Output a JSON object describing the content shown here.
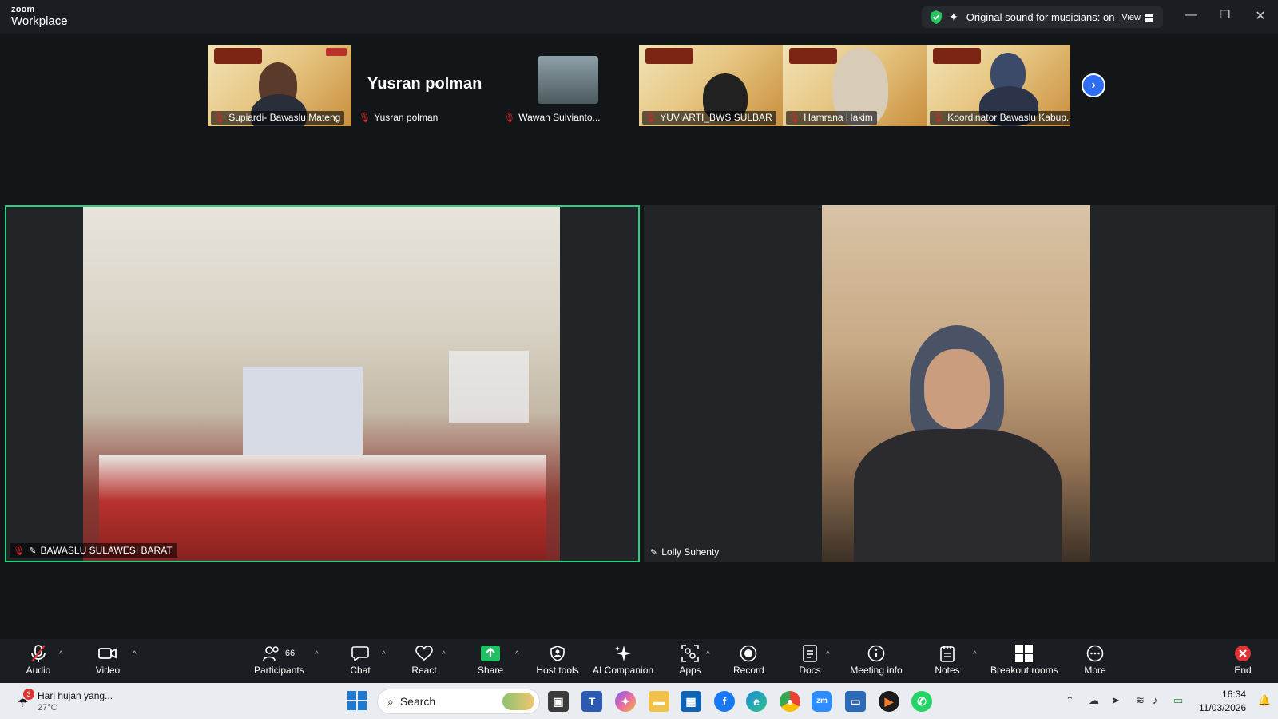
{
  "titlebar": {
    "brand_small": "zoom",
    "brand_large": "Workplace",
    "sound_status": "Original sound for musicians: on",
    "view_label": "View",
    "minimize": "—",
    "restore": "❐",
    "close": "✕"
  },
  "gallery": {
    "tiles": [
      {
        "label": "Supiardi- Bawaslu Mateng"
      },
      {
        "label": "Yusran polman",
        "display_name": "Yusran polman"
      },
      {
        "label": "Wawan Sulvianto..."
      },
      {
        "label": "YUVIARTI_BWS SULBAR"
      },
      {
        "label": "Hamrana Hakim"
      },
      {
        "label": "Koordinator Bawaslu Kabup..."
      }
    ],
    "next_icon": "›"
  },
  "main": {
    "left_label": "BAWASLU SULAWESI BARAT",
    "right_label": "Lolly Suhenty"
  },
  "toolbar": {
    "audio": "Audio",
    "video": "Video",
    "participants": "Participants",
    "participants_count": "66",
    "chat": "Chat",
    "react": "React",
    "share": "Share",
    "host_tools": "Host tools",
    "ai_companion": "AI Companion",
    "apps": "Apps",
    "record": "Record",
    "docs": "Docs",
    "meeting_info": "Meeting info",
    "notes": "Notes",
    "breakout_rooms": "Breakout rooms",
    "more": "More",
    "end": "End",
    "colors": {
      "accent": "#2d6ef5",
      "share": "#21c065",
      "end": "#e03333",
      "speaker_border": "#27d17f"
    }
  },
  "taskbar": {
    "weather_text": "Hari hujan yang...",
    "weather_temp": "27°C",
    "weather_badge": "3",
    "search_placeholder": "Search",
    "time": "16:34",
    "date": "11/03/2026"
  }
}
